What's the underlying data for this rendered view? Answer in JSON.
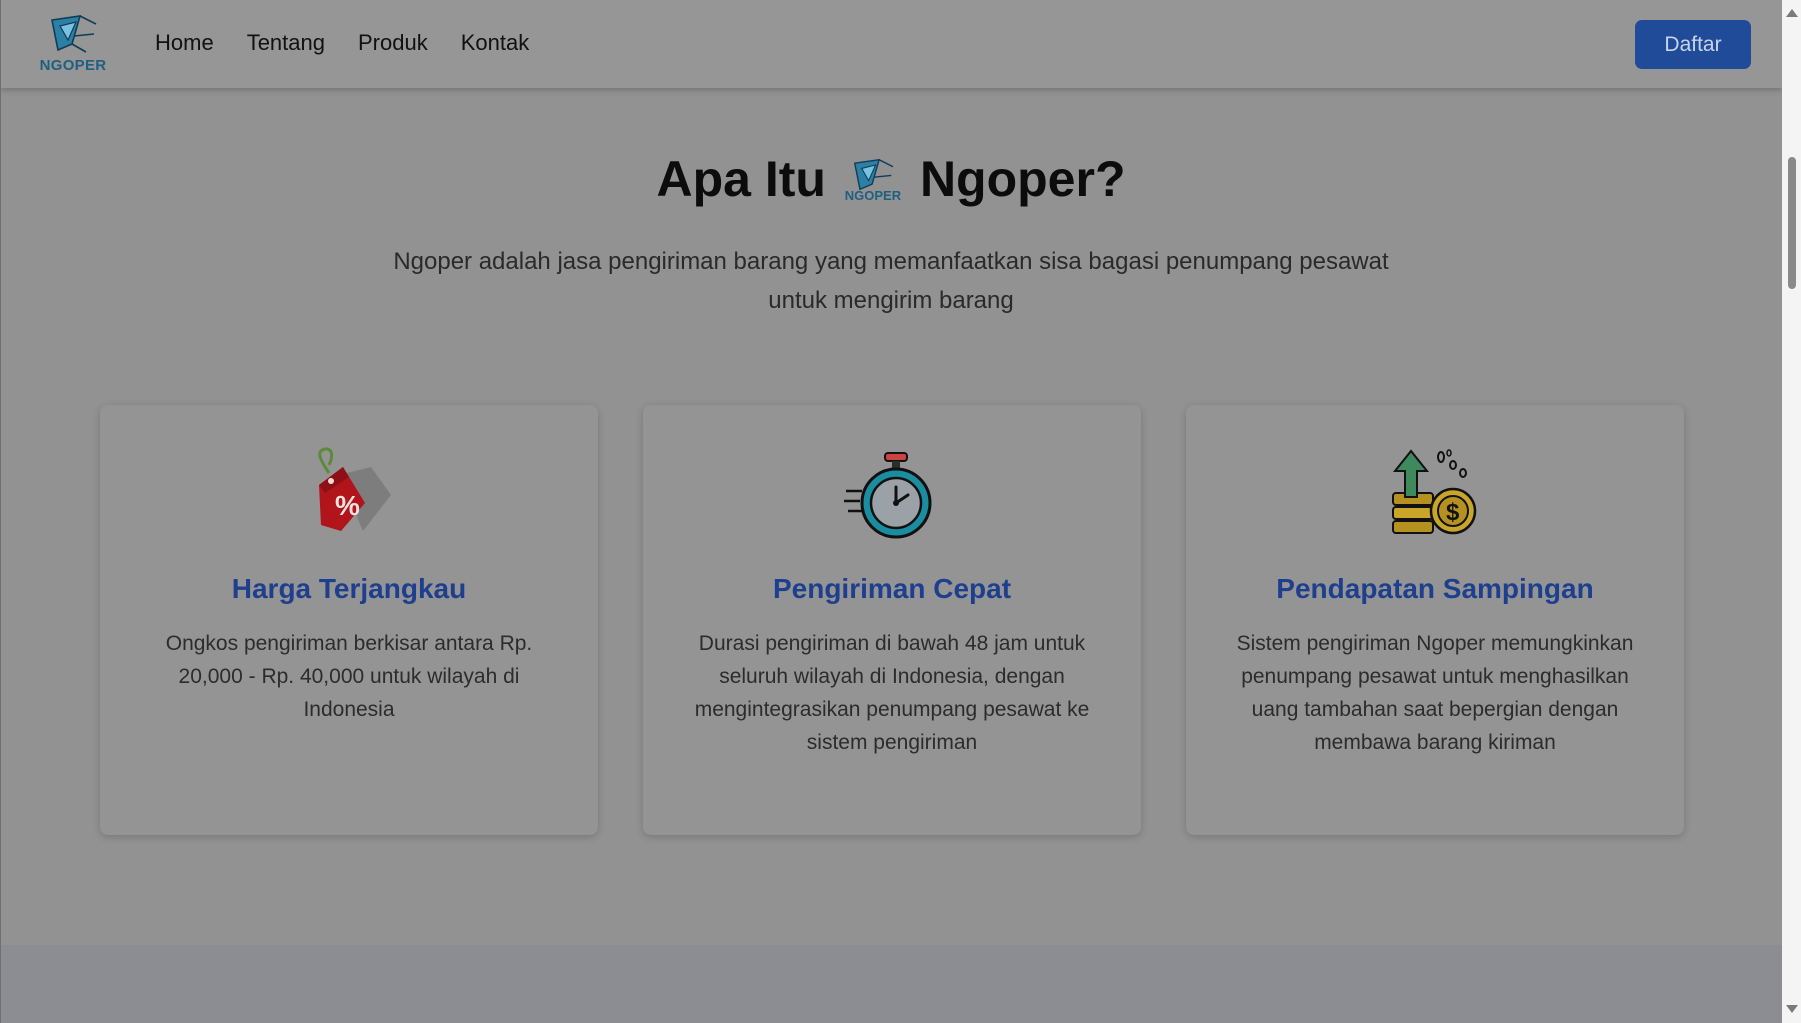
{
  "navbar": {
    "logo_text": "NGOPER",
    "links": [
      "Home",
      "Tentang",
      "Produk",
      "Kontak"
    ],
    "cta_label": "Daftar"
  },
  "hero": {
    "title_before": "Apa Itu",
    "title_logo_text": "NGOPER",
    "title_after": "Ngoper?",
    "description": "Ngoper adalah jasa pengiriman barang yang memanfaatkan sisa bagasi penumpang pesawat untuk mengirim barang"
  },
  "features": [
    {
      "icon": "price-tag-percent-icon",
      "title": "Harga Terjangkau",
      "text": "Ongkos pengiriman berkisar antara Rp. 20,000 - Rp. 40,000 untuk wilayah di Indonesia"
    },
    {
      "icon": "stopwatch-icon",
      "title": "Pengiriman Cepat",
      "text": "Durasi pengiriman di bawah 48 jam untuk seluruh wilayah di Indonesia, dengan mengintegrasikan penumpang pesawat ke sistem pengiriman"
    },
    {
      "icon": "coins-growth-icon",
      "title": "Pendapatan Sampingan",
      "text": "Sistem pengiriman Ngoper memungkinkan penumpang pesawat untuk menghasilkan uang tambahan saat bepergian dengan membawa barang kiriman"
    }
  ],
  "colors": {
    "accent": "#1f4b99",
    "card_title": "#1e3f8e",
    "logo": "#1f5f82"
  }
}
